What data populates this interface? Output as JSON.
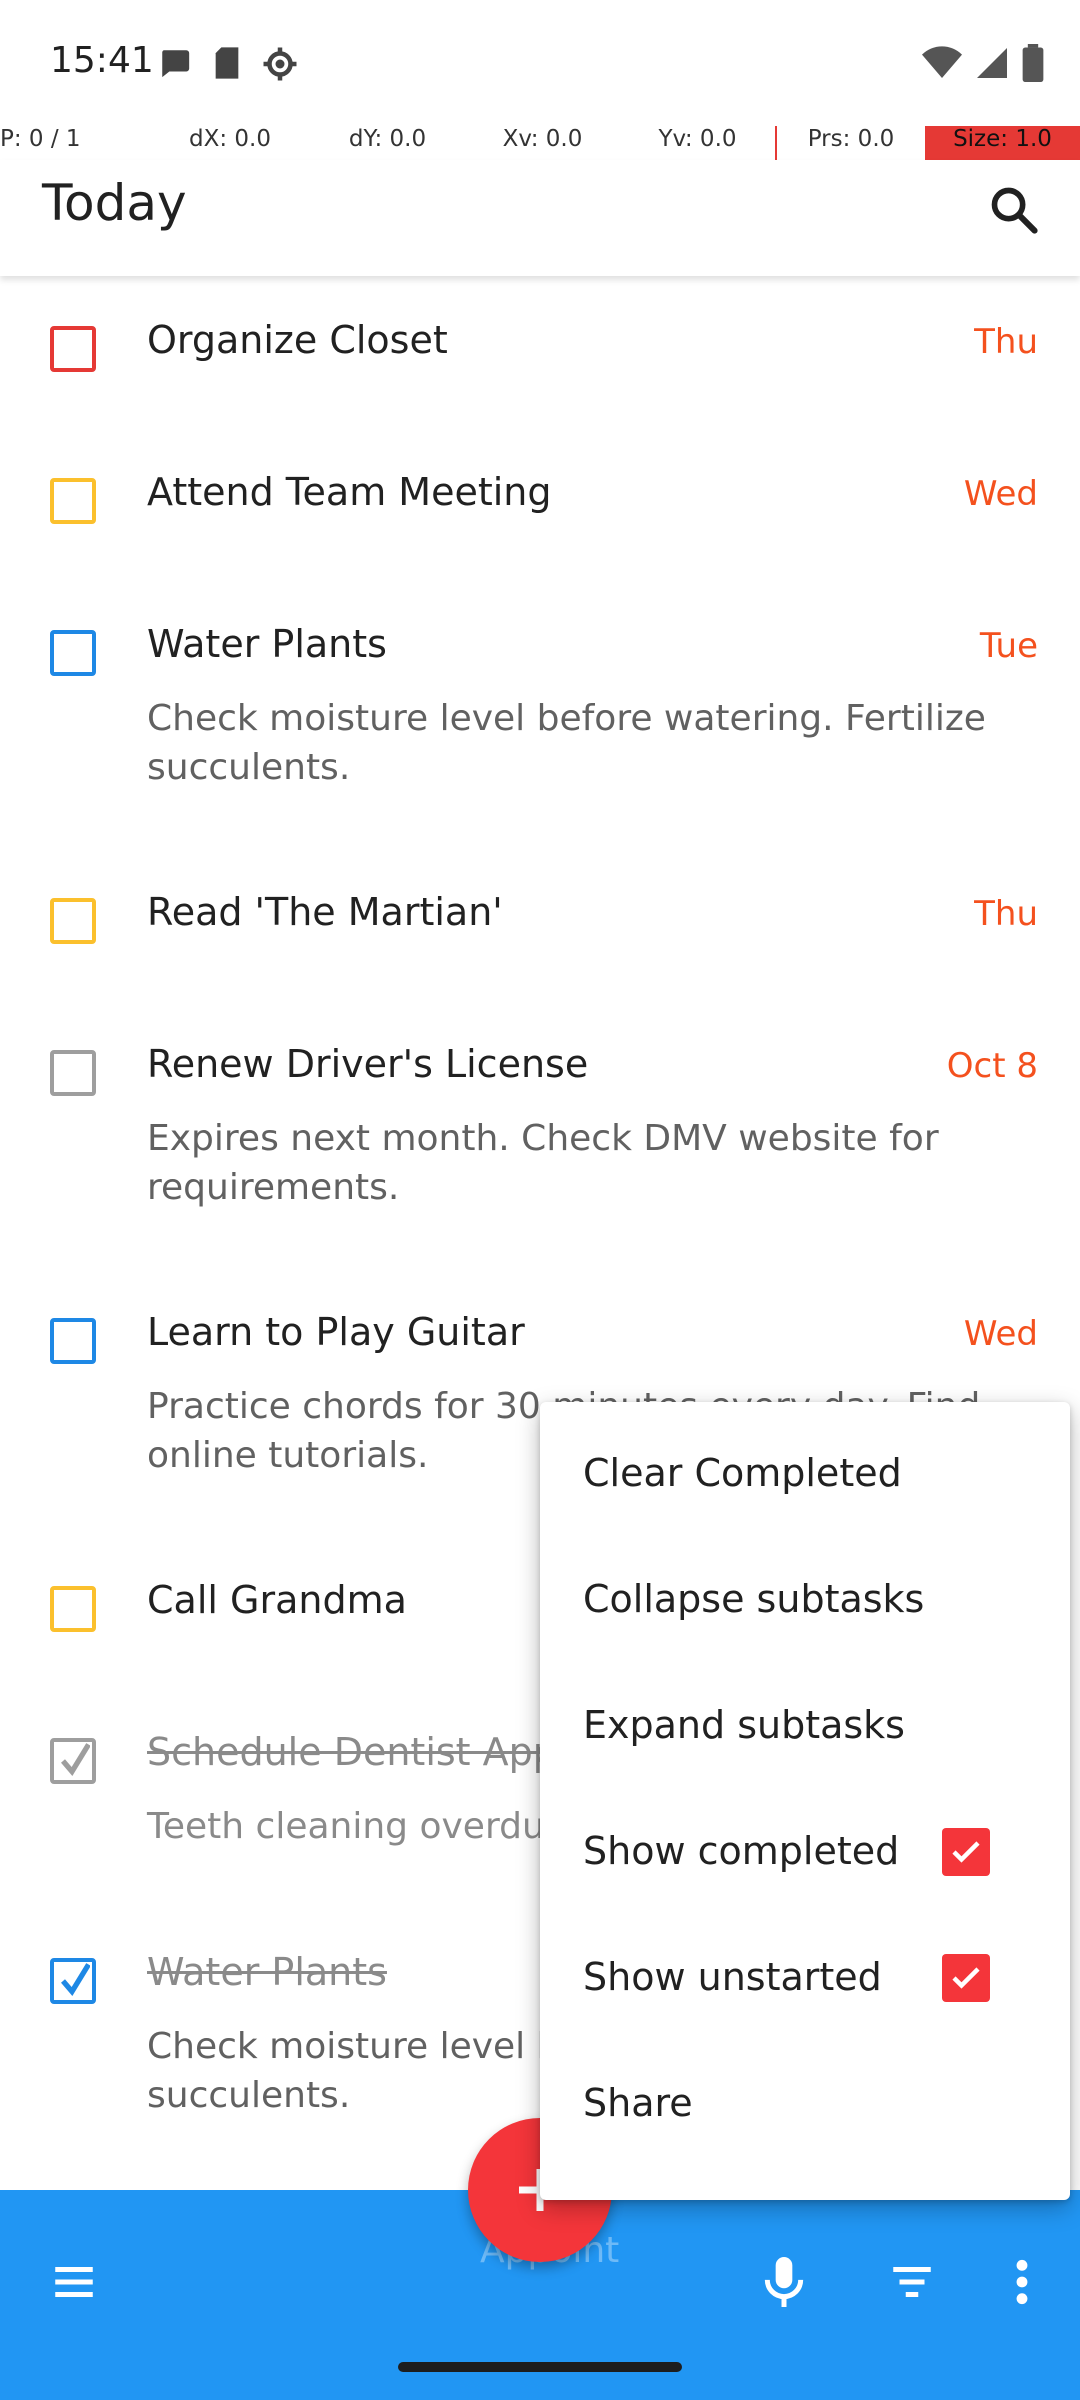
{
  "status_bar": {
    "time": "15:41"
  },
  "debug_bar": {
    "p": "P: 0 / 1",
    "dx": "dX: 0.0",
    "dy": "dY: 0.0",
    "xv": "Xv: 0.0",
    "yv": "Yv: 0.0",
    "prs": "Prs: 0.0",
    "size": "Size: 1.0"
  },
  "appbar": {
    "title": "Today"
  },
  "tasks": [
    {
      "title": "Organize Closet",
      "due": "Thu",
      "notes": ""
    },
    {
      "title": "Attend Team Meeting",
      "due": "Wed",
      "notes": ""
    },
    {
      "title": "Water Plants",
      "due": "Tue",
      "notes": "Check moisture level before watering. Fertilize succulents."
    },
    {
      "title": "Read 'The Martian'",
      "due": "Thu",
      "notes": ""
    },
    {
      "title": "Renew Driver's License",
      "due": "Oct 8",
      "notes": "Expires next month. Check DMV website for requirements."
    },
    {
      "title": "Learn to Play Guitar",
      "due": "Wed",
      "notes": "Practice chords for 30 minutes every day. Find online tutorials."
    },
    {
      "title": "Call Grandma",
      "due": "",
      "notes": ""
    },
    {
      "title": "Schedule Dentist Appointment",
      "due": "",
      "notes": "Teeth cleaning overdue."
    },
    {
      "title": "Water Plants",
      "due": "",
      "notes": "Check moisture level before watering. Fertilize succulents."
    }
  ],
  "menu": {
    "clear_completed": "Clear Completed",
    "collapse_subtasks": "Collapse subtasks",
    "expand_subtasks": "Expand subtasks",
    "show_completed": "Show completed",
    "show_unstarted": "Show unstarted",
    "share": "Share"
  },
  "bottom_bar": {
    "ghost_text": "Appoint"
  },
  "colors": {
    "accent": "#2196f3",
    "fab": "#f4353a",
    "due_text": "#f4511e"
  }
}
